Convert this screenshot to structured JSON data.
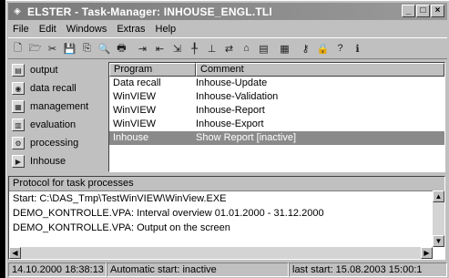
{
  "window": {
    "title": "ELSTER - Task-Manager: INHOUSE_ENGL.TLI",
    "minimize": "_",
    "maximize": "□",
    "close": "×"
  },
  "menu": [
    "File",
    "Edit",
    "Windows",
    "Extras",
    "Help"
  ],
  "toolbar": {
    "icons": [
      "new-icon",
      "open-icon",
      "cut-icon",
      "save-icon",
      "copy-icon",
      "preview-icon",
      "print-icon",
      "insert-icon",
      "export-icon",
      "import-icon",
      "step-icon",
      "align-icon",
      "transfer-icon",
      "home-icon",
      "database-icon",
      "chart-icon",
      "key-icon",
      "lock-icon",
      "help-cursor-icon",
      "info-icon"
    ],
    "glyphs": [
      "🗋",
      "🗁",
      "✂",
      "💾",
      "⎘",
      "🔍",
      "🖶",
      "⇥",
      "⇤",
      "⇲",
      "╀",
      "⊥",
      "⇄",
      "⌂",
      "▤",
      "▦",
      "⚷",
      "🔒",
      "?",
      "ℹ"
    ]
  },
  "nav": [
    {
      "label": "output",
      "icon": "output-icon",
      "glyph": "▤"
    },
    {
      "label": "data recall",
      "icon": "data-recall-icon",
      "glyph": "◉"
    },
    {
      "label": "management",
      "icon": "management-icon",
      "glyph": "▦"
    },
    {
      "label": "evaluation",
      "icon": "evaluation-icon",
      "glyph": "▥"
    },
    {
      "label": "processing",
      "icon": "processing-icon",
      "glyph": "⚙"
    },
    {
      "label": "Inhouse",
      "icon": "inhouse-icon",
      "glyph": "▶"
    }
  ],
  "list": {
    "headers": [
      "Program",
      "Comment"
    ],
    "rows": [
      [
        "Data recall",
        "Inhouse-Update"
      ],
      [
        "WinVIEW",
        "Inhouse-Validation"
      ],
      [
        "WinVIEW",
        "Inhouse-Report"
      ],
      [
        "WinVIEW",
        "Inhouse-Export"
      ],
      [
        "Inhouse",
        "Show Report [inactive]"
      ]
    ],
    "selected_index": 4
  },
  "protocol": {
    "header": "Protocol for task processes",
    "lines": [
      "Start: C:\\DAS_Tmp\\TestWinVIEW\\WinView.EXE",
      "DEMO_KONTROLLE.VPA: Interval overview 01.01.2000 - 31.12.2000",
      "DEMO_KONTROLLE.VPA: Output on the screen"
    ]
  },
  "status": {
    "time": "14.10.2000 18:38:13",
    "auto_start": "Automatic start: inactive",
    "last_start": "last start: 15.08.2003 15:00:1"
  },
  "colors": {
    "selection": "#8a8a8a",
    "titlebar": "#7a7a7a"
  }
}
